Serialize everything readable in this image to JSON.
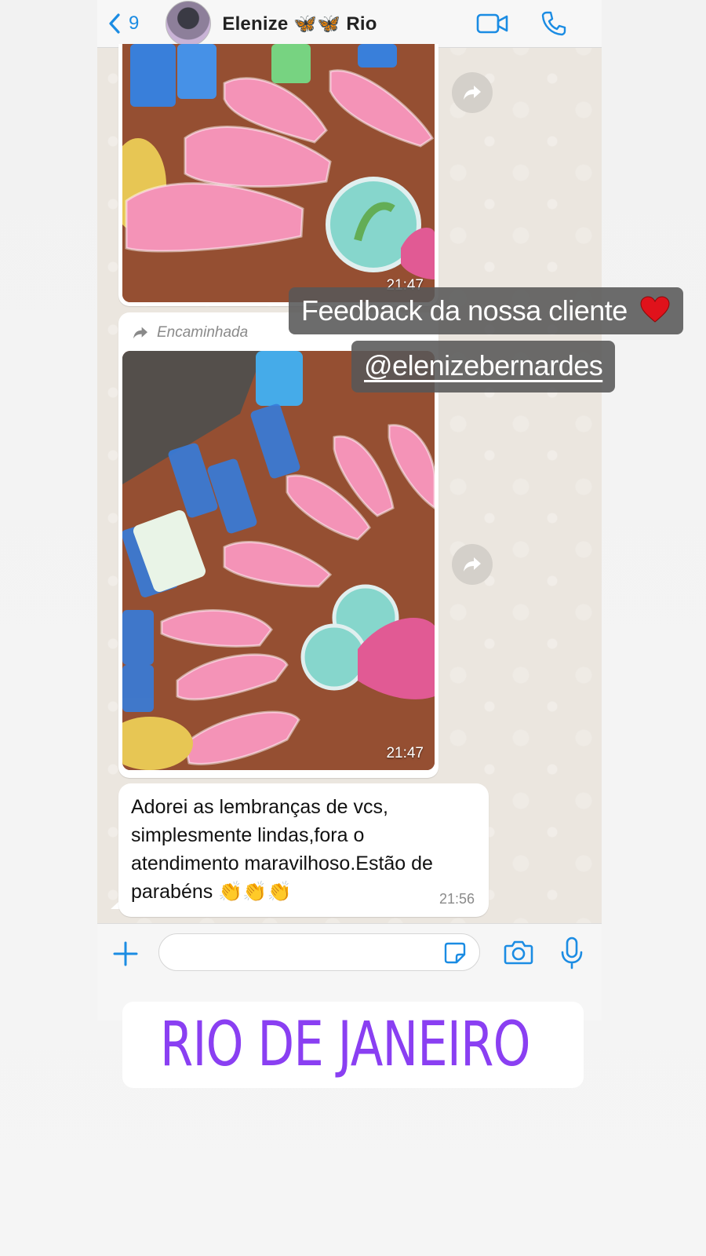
{
  "header": {
    "back_count": "9",
    "contact_name": "Elenize 🦋🦋 Rio"
  },
  "messages": {
    "photo1": {
      "time": "21:47"
    },
    "photo2": {
      "forward_label": "Encaminhada",
      "time": "21:47"
    },
    "text": {
      "body": "Adorei as lembranças de vcs, simplesmente lindas,fora o atendimento maravilhoso.Estão de parabéns 👏👏👏",
      "time": "21:56"
    }
  },
  "story": {
    "caption_line1": "Feedback da nossa cliente",
    "caption_mention": "@elenizebernardes",
    "location_text": "RIO DE JANEIRO"
  },
  "icons": {
    "back": "chevron-left-icon",
    "video": "video-camera-icon",
    "phone": "phone-icon",
    "forward": "forward-arrow-icon",
    "plus": "plus-icon",
    "sticker": "sticker-icon",
    "camera": "camera-icon",
    "mic": "microphone-icon",
    "location": "location-pin-icon",
    "heart": "heart-icon"
  },
  "colors": {
    "whatsapp_blue": "#1b8ce3",
    "location_purple": "#8a3ff2",
    "caption_bg": "#585858"
  }
}
